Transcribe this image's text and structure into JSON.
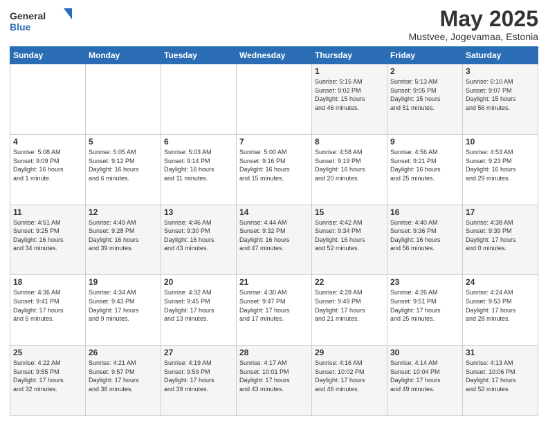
{
  "header": {
    "logo_line1": "General",
    "logo_line2": "Blue",
    "main_title": "May 2025",
    "subtitle": "Mustvee, Jogevamaa, Estonia"
  },
  "calendar": {
    "days_of_week": [
      "Sunday",
      "Monday",
      "Tuesday",
      "Wednesday",
      "Thursday",
      "Friday",
      "Saturday"
    ],
    "weeks": [
      [
        {
          "day": "",
          "info": ""
        },
        {
          "day": "",
          "info": ""
        },
        {
          "day": "",
          "info": ""
        },
        {
          "day": "",
          "info": ""
        },
        {
          "day": "1",
          "info": "Sunrise: 5:15 AM\nSunset: 9:02 PM\nDaylight: 15 hours\nand 46 minutes."
        },
        {
          "day": "2",
          "info": "Sunrise: 5:13 AM\nSunset: 9:05 PM\nDaylight: 15 hours\nand 51 minutes."
        },
        {
          "day": "3",
          "info": "Sunrise: 5:10 AM\nSunset: 9:07 PM\nDaylight: 15 hours\nand 56 minutes."
        }
      ],
      [
        {
          "day": "4",
          "info": "Sunrise: 5:08 AM\nSunset: 9:09 PM\nDaylight: 16 hours\nand 1 minute."
        },
        {
          "day": "5",
          "info": "Sunrise: 5:05 AM\nSunset: 9:12 PM\nDaylight: 16 hours\nand 6 minutes."
        },
        {
          "day": "6",
          "info": "Sunrise: 5:03 AM\nSunset: 9:14 PM\nDaylight: 16 hours\nand 11 minutes."
        },
        {
          "day": "7",
          "info": "Sunrise: 5:00 AM\nSunset: 9:16 PM\nDaylight: 16 hours\nand 15 minutes."
        },
        {
          "day": "8",
          "info": "Sunrise: 4:58 AM\nSunset: 9:19 PM\nDaylight: 16 hours\nand 20 minutes."
        },
        {
          "day": "9",
          "info": "Sunrise: 4:56 AM\nSunset: 9:21 PM\nDaylight: 16 hours\nand 25 minutes."
        },
        {
          "day": "10",
          "info": "Sunrise: 4:53 AM\nSunset: 9:23 PM\nDaylight: 16 hours\nand 29 minutes."
        }
      ],
      [
        {
          "day": "11",
          "info": "Sunrise: 4:51 AM\nSunset: 9:25 PM\nDaylight: 16 hours\nand 34 minutes."
        },
        {
          "day": "12",
          "info": "Sunrise: 4:49 AM\nSunset: 9:28 PM\nDaylight: 16 hours\nand 39 minutes."
        },
        {
          "day": "13",
          "info": "Sunrise: 4:46 AM\nSunset: 9:30 PM\nDaylight: 16 hours\nand 43 minutes."
        },
        {
          "day": "14",
          "info": "Sunrise: 4:44 AM\nSunset: 9:32 PM\nDaylight: 16 hours\nand 47 minutes."
        },
        {
          "day": "15",
          "info": "Sunrise: 4:42 AM\nSunset: 9:34 PM\nDaylight: 16 hours\nand 52 minutes."
        },
        {
          "day": "16",
          "info": "Sunrise: 4:40 AM\nSunset: 9:36 PM\nDaylight: 16 hours\nand 56 minutes."
        },
        {
          "day": "17",
          "info": "Sunrise: 4:38 AM\nSunset: 9:39 PM\nDaylight: 17 hours\nand 0 minutes."
        }
      ],
      [
        {
          "day": "18",
          "info": "Sunrise: 4:36 AM\nSunset: 9:41 PM\nDaylight: 17 hours\nand 5 minutes."
        },
        {
          "day": "19",
          "info": "Sunrise: 4:34 AM\nSunset: 9:43 PM\nDaylight: 17 hours\nand 9 minutes."
        },
        {
          "day": "20",
          "info": "Sunrise: 4:32 AM\nSunset: 9:45 PM\nDaylight: 17 hours\nand 13 minutes."
        },
        {
          "day": "21",
          "info": "Sunrise: 4:30 AM\nSunset: 9:47 PM\nDaylight: 17 hours\nand 17 minutes."
        },
        {
          "day": "22",
          "info": "Sunrise: 4:28 AM\nSunset: 9:49 PM\nDaylight: 17 hours\nand 21 minutes."
        },
        {
          "day": "23",
          "info": "Sunrise: 4:26 AM\nSunset: 9:51 PM\nDaylight: 17 hours\nand 25 minutes."
        },
        {
          "day": "24",
          "info": "Sunrise: 4:24 AM\nSunset: 9:53 PM\nDaylight: 17 hours\nand 28 minutes."
        }
      ],
      [
        {
          "day": "25",
          "info": "Sunrise: 4:22 AM\nSunset: 9:55 PM\nDaylight: 17 hours\nand 32 minutes."
        },
        {
          "day": "26",
          "info": "Sunrise: 4:21 AM\nSunset: 9:57 PM\nDaylight: 17 hours\nand 36 minutes."
        },
        {
          "day": "27",
          "info": "Sunrise: 4:19 AM\nSunset: 9:59 PM\nDaylight: 17 hours\nand 39 minutes."
        },
        {
          "day": "28",
          "info": "Sunrise: 4:17 AM\nSunset: 10:01 PM\nDaylight: 17 hours\nand 43 minutes."
        },
        {
          "day": "29",
          "info": "Sunrise: 4:16 AM\nSunset: 10:02 PM\nDaylight: 17 hours\nand 46 minutes."
        },
        {
          "day": "30",
          "info": "Sunrise: 4:14 AM\nSunset: 10:04 PM\nDaylight: 17 hours\nand 49 minutes."
        },
        {
          "day": "31",
          "info": "Sunrise: 4:13 AM\nSunset: 10:06 PM\nDaylight: 17 hours\nand 52 minutes."
        }
      ]
    ]
  }
}
